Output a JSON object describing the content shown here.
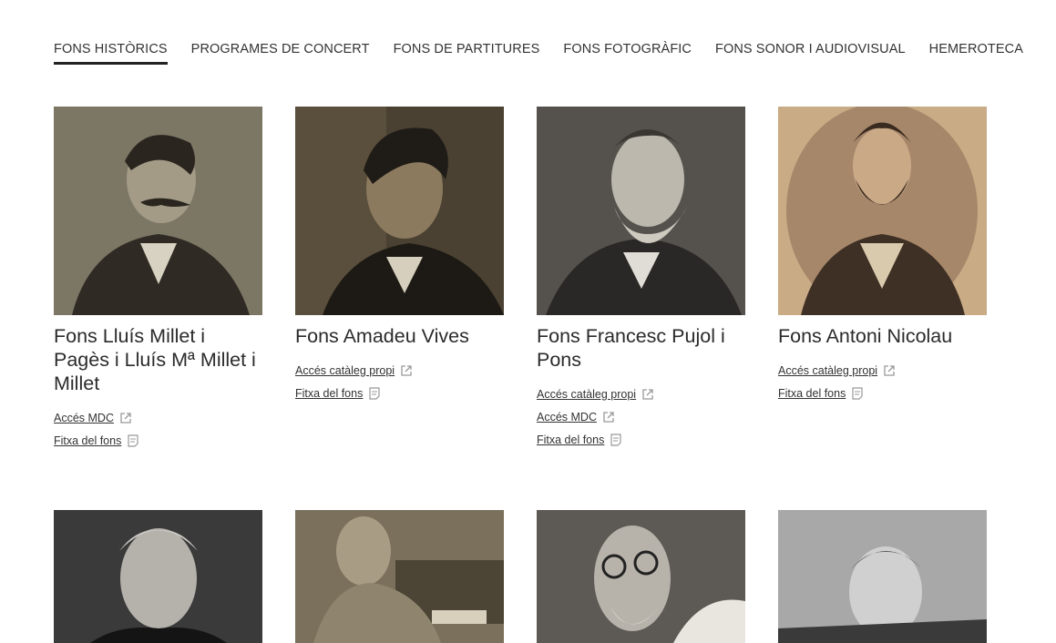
{
  "tabs": [
    {
      "label": "FONS HISTÒRICS",
      "active": true
    },
    {
      "label": "PROGRAMES DE CONCERT",
      "active": false
    },
    {
      "label": "FONS DE PARTITURES",
      "active": false
    },
    {
      "label": "FONS FOTOGRÀFIC",
      "active": false
    },
    {
      "label": "FONS SONOR I AUDIOVISUAL",
      "active": false
    },
    {
      "label": "HEMEROTECA",
      "active": false
    }
  ],
  "cards": [
    {
      "title": "Fons Lluís Millet i Pagès i Lluís Mª Millet i Millet",
      "links": [
        {
          "label": "Accés MDC",
          "icon": "external-link-icon"
        },
        {
          "label": "Fitxa del fons",
          "icon": "document-icon"
        }
      ],
      "photo_tone": "#6b6455"
    },
    {
      "title": "Fons Amadeu Vives",
      "links": [
        {
          "label": "Accés catàleg propi",
          "icon": "external-link-icon"
        },
        {
          "label": "Fitxa del fons",
          "icon": "document-icon"
        }
      ],
      "photo_tone": "#4a4132"
    },
    {
      "title": "Fons Francesc Pujol i Pons",
      "links": [
        {
          "label": "Accés catàleg propi",
          "icon": "external-link-icon"
        },
        {
          "label": "Accés MDC",
          "icon": "external-link-icon"
        },
        {
          "label": "Fitxa del fons",
          "icon": "document-icon"
        }
      ],
      "photo_tone": "#3f3c38"
    },
    {
      "title": "Fons Antoni Nicolau",
      "links": [
        {
          "label": "Accés catàleg propi",
          "icon": "external-link-icon"
        },
        {
          "label": "Fitxa del fons",
          "icon": "document-icon"
        }
      ],
      "photo_tone": "#b0936f"
    }
  ],
  "second_row_photos": [
    {
      "photo_tone": "#3a3a3a"
    },
    {
      "photo_tone": "#6e6553"
    },
    {
      "photo_tone": "#55524d"
    },
    {
      "photo_tone": "#8a8a8a"
    }
  ],
  "colors": {
    "text": "#333333",
    "active_underline": "#222222",
    "link_icon": "#999999"
  }
}
